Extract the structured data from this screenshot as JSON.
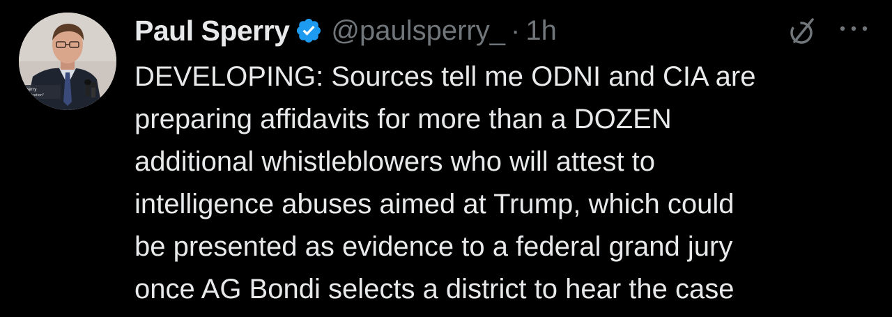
{
  "author": {
    "display_name": "Paul Sperry",
    "handle": "@paulsperry_",
    "separator": "·",
    "time": "1h",
    "verified_icon": "verified-badge-icon",
    "avatar_caption_lines": [
      "Sperry",
      "\"Infiltration\""
    ]
  },
  "tweet": {
    "lines": [
      "DEVELOPING: Sources tell me ODNI and CIA are",
      "preparing affidavits for more than a DOZEN",
      "additional whistleblowers who will attest to",
      "intelligence abuses aimed at Trump, which could",
      "be presented as evidence to a federal grand jury",
      "once AG Bondi selects a district to hear the case"
    ]
  },
  "actions": {
    "grok_icon": "grok-icon",
    "more_icon": "more-icon"
  },
  "colors": {
    "background": "#000000",
    "text_primary": "#e7e9ea",
    "text_secondary": "#71767b",
    "verified_blue": "#1d9bf0"
  }
}
